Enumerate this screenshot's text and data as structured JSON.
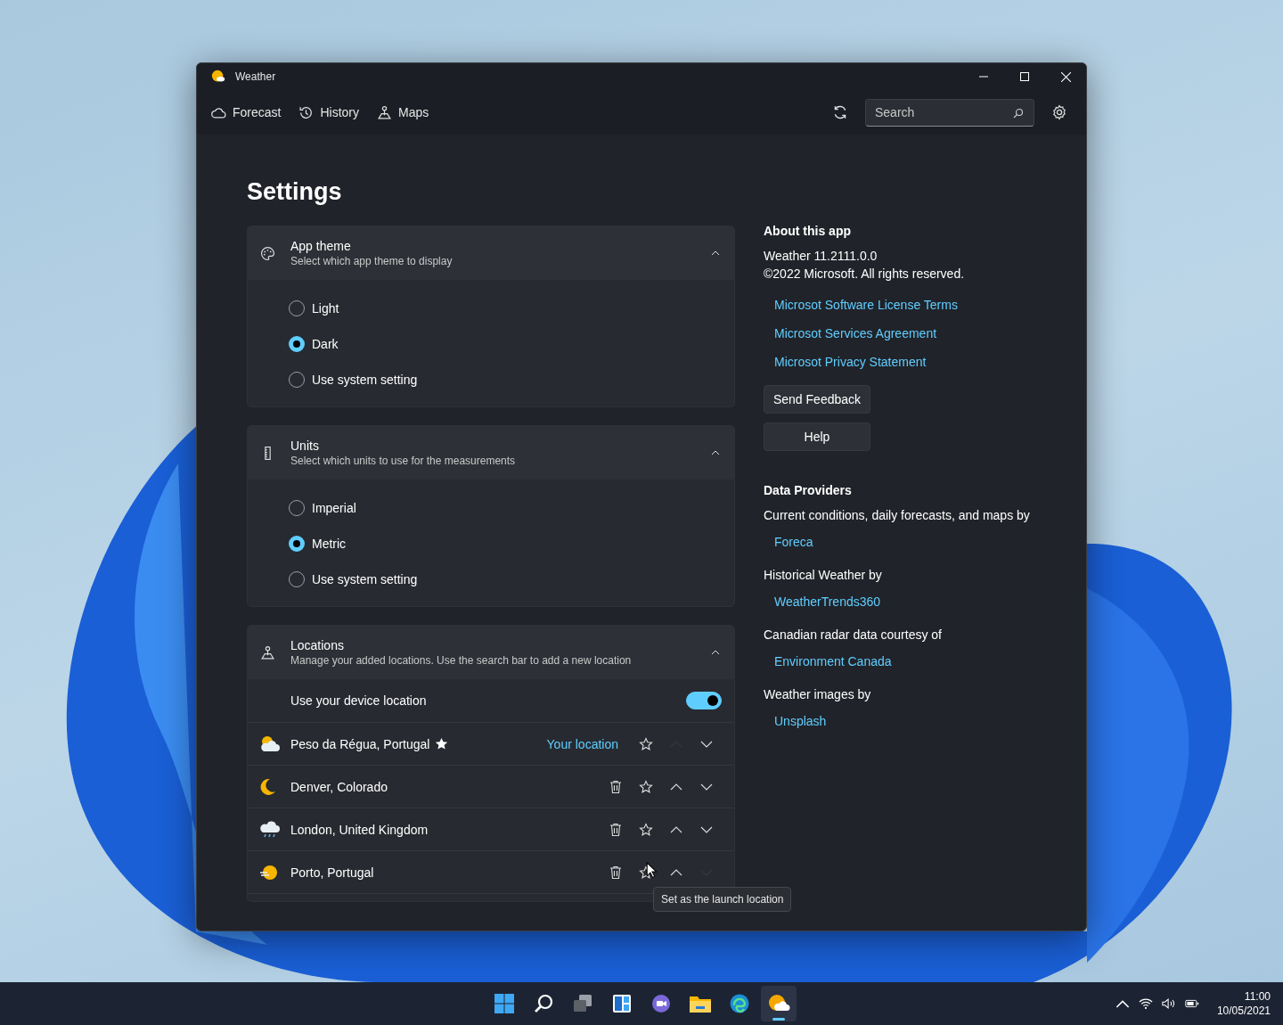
{
  "window": {
    "title": "Weather"
  },
  "nav": {
    "tabs": [
      {
        "label": "Forecast",
        "kind": "forecast"
      },
      {
        "label": "History",
        "kind": "history"
      },
      {
        "label": "Maps",
        "kind": "maps"
      }
    ],
    "search": {
      "placeholder": "Search"
    }
  },
  "page": {
    "title": "Settings"
  },
  "sections": [
    {
      "kind": "radio",
      "title": "App theme",
      "subtitle": "Select which app theme to display",
      "expanded": true,
      "options": [
        {
          "label": "Light",
          "selected": false
        },
        {
          "label": "Dark",
          "selected": true
        },
        {
          "label": "Use system setting",
          "selected": false
        }
      ]
    },
    {
      "kind": "radio",
      "title": "Units",
      "subtitle": "Select which units to use for the measurements",
      "expanded": true,
      "options": [
        {
          "label": "Imperial",
          "selected": false
        },
        {
          "label": "Metric",
          "selected": true
        },
        {
          "label": "Use system setting",
          "selected": false
        }
      ]
    },
    {
      "kind": "locations",
      "title": "Locations",
      "subtitle": "Manage your added locations. Use the search bar to add a new location",
      "expanded": true,
      "device_location": {
        "label": "Use your device location",
        "on": true
      },
      "locations": [
        {
          "name": "Peso da Régua, Portugal",
          "kind": "partly-cloudy",
          "favorite": true,
          "badge": "Your location",
          "removable": false,
          "up_disabled": true,
          "down_disabled": false
        },
        {
          "name": "Denver, Colorado",
          "kind": "moon",
          "favorite": false,
          "removable": true,
          "up_disabled": false,
          "down_disabled": false
        },
        {
          "name": "London, United Kingdom",
          "kind": "rain",
          "favorite": false,
          "removable": true,
          "up_disabled": false,
          "down_disabled": false
        },
        {
          "name": "Porto, Portugal",
          "kind": "haze",
          "favorite": false,
          "removable": true,
          "up_disabled": false,
          "down_disabled": true
        }
      ]
    }
  ],
  "tooltip": "Set as the launch location",
  "about": {
    "heading": "About this app",
    "version": "Weather 11.2111.0.0",
    "copyright": "©2022 Microsoft. All rights reserved.",
    "links": [
      "Microsot Software License Terms",
      "Microsot Services Agreement",
      "Microsot Privacy Statement"
    ],
    "buttons": [
      "Send Feedback",
      "Help"
    ]
  },
  "providers": {
    "heading": "Data Providers",
    "entries": [
      {
        "text": "Current conditions, daily forecasts, and maps by",
        "link": "Foreca"
      },
      {
        "text": "Historical Weather by",
        "link": "WeatherTrends360"
      },
      {
        "text": "Canadian radar data courtesy of",
        "link": "Environment Canada"
      },
      {
        "text": "Weather images by",
        "link": "Unsplash"
      }
    ]
  },
  "taskbar": {
    "apps": [
      {
        "kind": "start",
        "active": false
      },
      {
        "kind": "search",
        "active": false
      },
      {
        "kind": "task-view",
        "active": false
      },
      {
        "kind": "widgets",
        "active": false
      },
      {
        "kind": "chat",
        "active": false
      },
      {
        "kind": "explorer",
        "active": false
      },
      {
        "kind": "edge",
        "active": false
      },
      {
        "kind": "weather",
        "active": true
      }
    ],
    "time": "11:00",
    "date": "10/05/2021"
  }
}
